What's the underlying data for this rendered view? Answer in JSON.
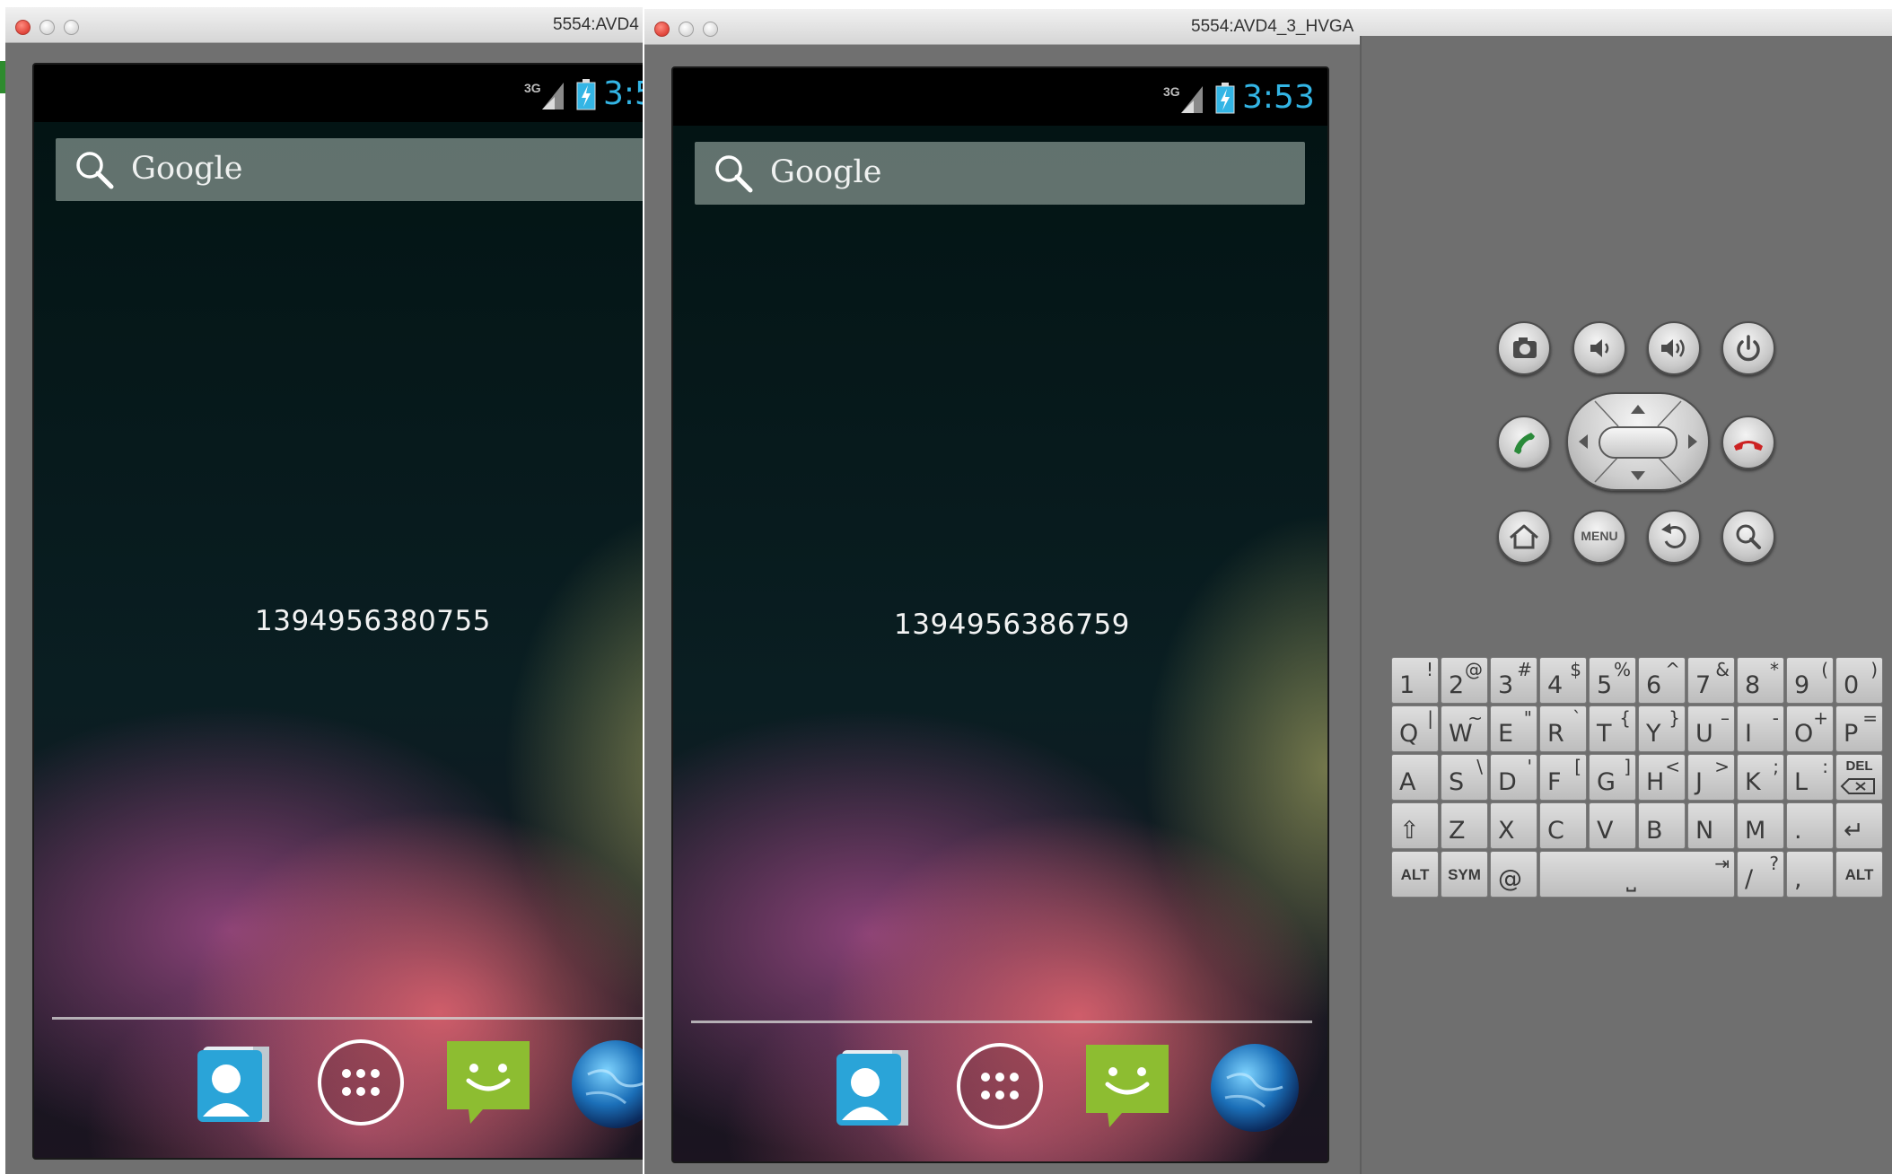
{
  "windows": [
    {
      "title": "5554:AVD4",
      "status": {
        "network": "3G",
        "clock": "3:5"
      },
      "search_label": "Google",
      "timestamp": "1394956380755"
    },
    {
      "title": "5554:AVD4_3_HVGA",
      "status": {
        "network": "3G",
        "clock": "3:53"
      },
      "search_label": "Google",
      "timestamp": "1394956386759"
    }
  ],
  "dock_icons": [
    "contacts-icon",
    "app-drawer-icon",
    "messaging-icon",
    "browser-globe-icon"
  ],
  "controls": {
    "menu_label": "MENU",
    "buttons": [
      "camera-icon",
      "volume-down-icon",
      "volume-up-icon",
      "power-icon",
      "call-icon",
      "end-call-icon",
      "home-icon",
      "menu-button",
      "back-icon",
      "search-icon"
    ]
  },
  "keyboard": {
    "rows": [
      [
        {
          "main": "1",
          "alt": "!"
        },
        {
          "main": "2",
          "alt": "@"
        },
        {
          "main": "3",
          "alt": "#"
        },
        {
          "main": "4",
          "alt": "$"
        },
        {
          "main": "5",
          "alt": "%"
        },
        {
          "main": "6",
          "alt": "^"
        },
        {
          "main": "7",
          "alt": "&"
        },
        {
          "main": "8",
          "alt": "*"
        },
        {
          "main": "9",
          "alt": "("
        },
        {
          "main": "0",
          "alt": ")"
        }
      ],
      [
        {
          "main": "Q",
          "alt": "|"
        },
        {
          "main": "W",
          "alt": "~"
        },
        {
          "main": "E",
          "alt": "\""
        },
        {
          "main": "R",
          "alt": "`"
        },
        {
          "main": "T",
          "alt": "{"
        },
        {
          "main": "Y",
          "alt": "}"
        },
        {
          "main": "U",
          "alt": "–"
        },
        {
          "main": "I",
          "alt": "-"
        },
        {
          "main": "O",
          "alt": "+"
        },
        {
          "main": "P",
          "alt": "="
        }
      ],
      [
        {
          "main": "A",
          "alt": ""
        },
        {
          "main": "S",
          "alt": "\\"
        },
        {
          "main": "D",
          "alt": "'"
        },
        {
          "main": "F",
          "alt": "["
        },
        {
          "main": "G",
          "alt": "]"
        },
        {
          "main": "H",
          "alt": "<"
        },
        {
          "main": "J",
          "alt": ">"
        },
        {
          "main": "K",
          "alt": ";"
        },
        {
          "main": "L",
          "alt": ":"
        },
        {
          "main": "DEL",
          "alt": "",
          "small": true
        }
      ],
      [
        {
          "main": "⇧",
          "alt": ""
        },
        {
          "main": "Z",
          "alt": ""
        },
        {
          "main": "X",
          "alt": ""
        },
        {
          "main": "C",
          "alt": ""
        },
        {
          "main": "V",
          "alt": ""
        },
        {
          "main": "B",
          "alt": ""
        },
        {
          "main": "N",
          "alt": ""
        },
        {
          "main": "M",
          "alt": ""
        },
        {
          "main": ".",
          "alt": ""
        },
        {
          "main": "↵",
          "alt": ""
        }
      ]
    ],
    "bottom_row": {
      "alt_left": "ALT",
      "sym": "SYM",
      "at": "@",
      "space": "⎵",
      "tab": "⇥",
      "slash": "/",
      "slash_alt": "?",
      "comma": ",",
      "alt_right": "ALT"
    }
  }
}
